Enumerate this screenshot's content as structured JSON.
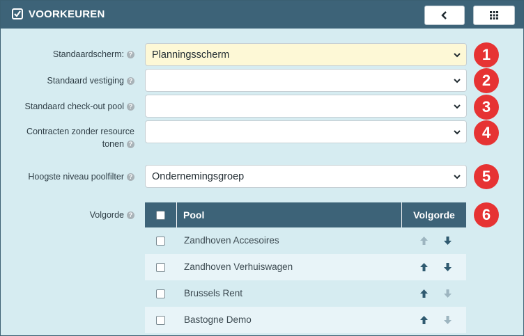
{
  "header": {
    "title": "VOORKEUREN",
    "title_icon": "checkbox-icon",
    "back_icon": "chevron-left-icon",
    "grid_icon": "grid-icon",
    "background": "#3d6378"
  },
  "fields": [
    {
      "label": "Standaardscherm:",
      "value": "Planningsscherm",
      "badge": "1"
    },
    {
      "label": "Standaard vestiging",
      "value": "",
      "badge": "2"
    },
    {
      "label": "Standaard check-out pool",
      "value": "",
      "badge": "3"
    },
    {
      "label_line1": "Contracten zonder resource",
      "label_line2": "tonen",
      "value": "",
      "badge": "4"
    },
    {
      "label": "Hoogste niveau poolfilter",
      "value": "Ondernemingsgroep",
      "badge": "5"
    }
  ],
  "order": {
    "label": "Volgorde",
    "badge": "6",
    "columns": {
      "pool": "Pool",
      "order": "Volgorde"
    },
    "rows": [
      {
        "name": "Zandhoven Accesoires",
        "up_enabled": false,
        "down_enabled": true
      },
      {
        "name": "Zandhoven Verhuiswagen",
        "up_enabled": true,
        "down_enabled": true
      },
      {
        "name": "Brussels Rent",
        "up_enabled": true,
        "down_enabled": false
      },
      {
        "name": "Bastogne Demo",
        "up_enabled": true,
        "down_enabled": false
      }
    ]
  },
  "help_glyph": "?",
  "colors": {
    "badge": "#e63333",
    "highlight_select": "#fdf8d6",
    "panel_bg": "#d6ecf1",
    "arrow_active": "#2f5a70",
    "arrow_disabled": "#9db5c0"
  }
}
